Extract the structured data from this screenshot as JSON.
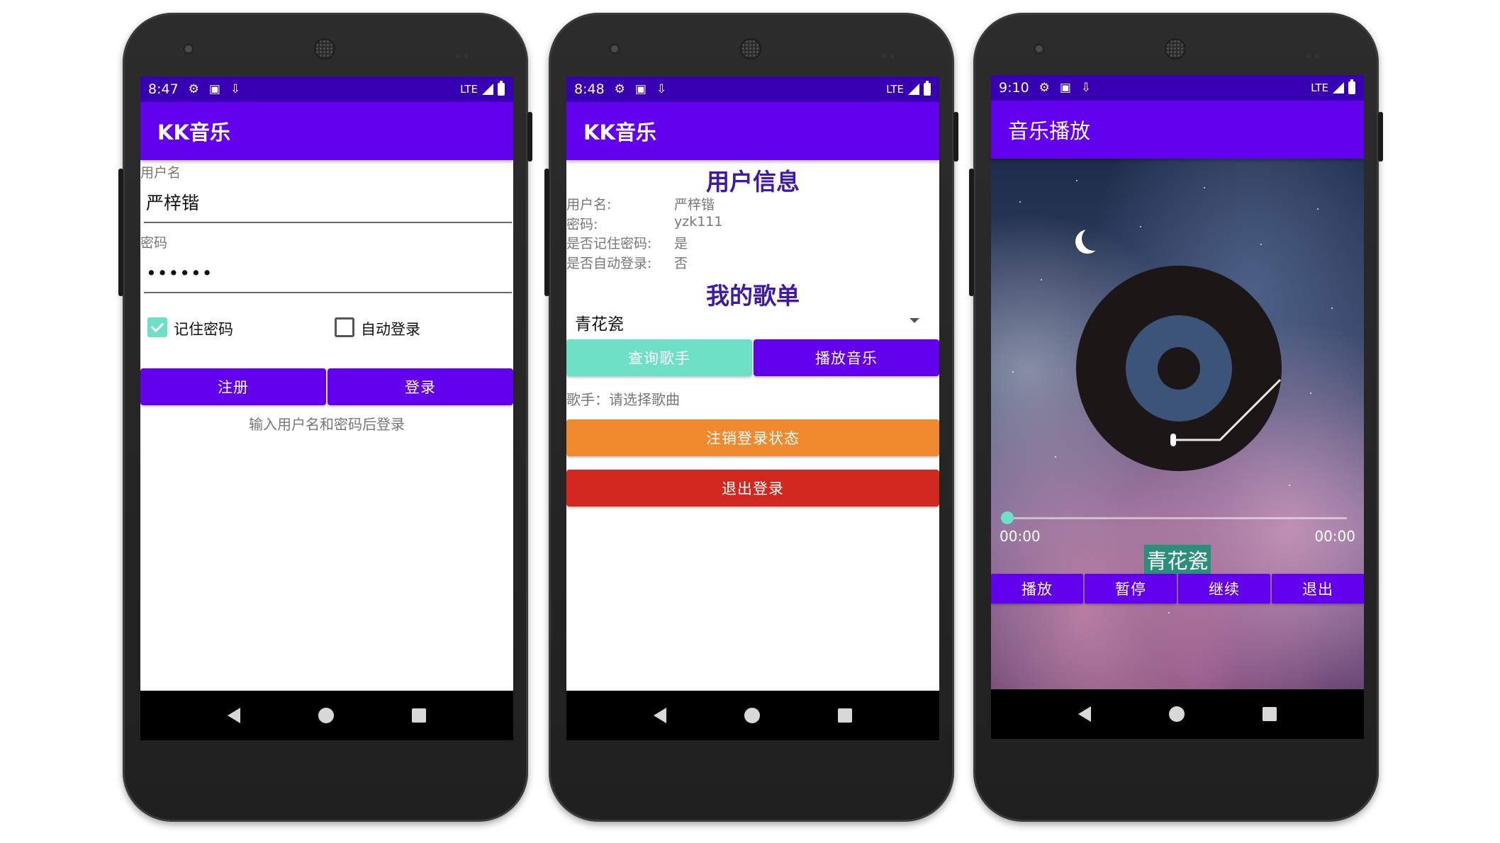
{
  "colors": {
    "status_bar": "#3700b3",
    "app_bar": "#6200ee",
    "teal": "#6ee0c6",
    "orange": "#f08a2e",
    "red": "#d0281e",
    "heading_purple": "#3f1aa8"
  },
  "login_screen": {
    "status": {
      "time": "8:47",
      "network": "LTE"
    },
    "app_title": "KK音乐",
    "username_label": "用户名",
    "username_value": "严梓锴",
    "password_label": "密码",
    "password_value": "••••••",
    "remember_label": "记住密码",
    "remember_checked": true,
    "autologin_label": "自动登录",
    "autologin_checked": false,
    "register_button": "注册",
    "login_button": "登录",
    "hint": "输入用户名和密码后登录"
  },
  "user_screen": {
    "status": {
      "time": "8:48",
      "network": "LTE"
    },
    "app_title": "KK音乐",
    "info_heading": "用户信息",
    "rows": [
      {
        "label": "用户名:",
        "value": "严梓锴"
      },
      {
        "label": "密码:",
        "value": "yzk111"
      },
      {
        "label": "是否记住密码:",
        "value": "是"
      },
      {
        "label": "是否自动登录:",
        "value": "否"
      }
    ],
    "playlist_heading": "我的歌单",
    "selected_song": "青花瓷",
    "query_singer_button": "查询歌手",
    "play_music_button": "播放音乐",
    "singer_text": "歌手：请选择歌曲",
    "logout_state_button": "注销登录状态",
    "exit_login_button": "退出登录"
  },
  "player_screen": {
    "status": {
      "time": "9:10",
      "network": "LTE"
    },
    "app_title": "音乐播放",
    "current_time": "00:00",
    "total_time": "00:00",
    "progress": 0,
    "song_title": "青花瓷",
    "buttons": {
      "play": "播放",
      "pause": "暂停",
      "resume": "继续",
      "exit": "退出"
    }
  }
}
